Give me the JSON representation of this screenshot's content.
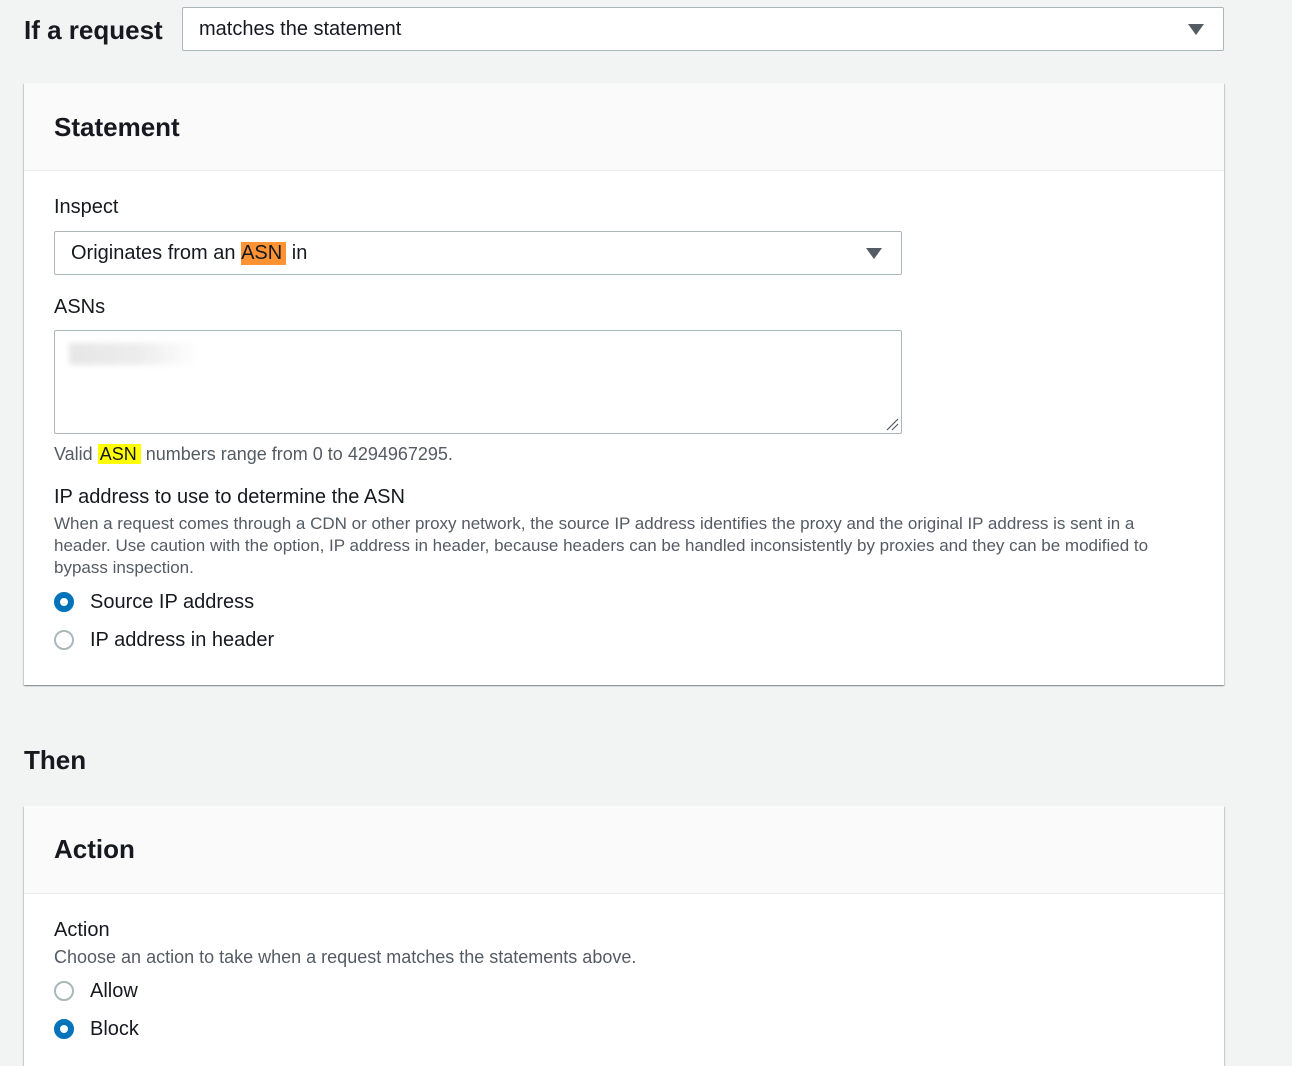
{
  "rule": {
    "if_label": "If a request",
    "match_select": {
      "value": "matches the statement"
    }
  },
  "statement": {
    "title": "Statement",
    "inspect": {
      "label": "Inspect",
      "value_prefix": "Originates from an ",
      "value_highlight": "ASN",
      "value_suffix": " in"
    },
    "asns": {
      "label": "ASNs",
      "value": "",
      "hint_prefix": "Valid ",
      "hint_highlight": "ASN",
      "hint_suffix": " numbers range from 0 to 4294967295."
    },
    "ip_source": {
      "label": "IP address to use to determine the ASN",
      "description": "When a request comes through a CDN or other proxy network, the source IP address identifies the proxy and the original IP address is sent in a header. Use caution with the option, IP address in header, because headers can be handled inconsistently by proxies and they can be modified to bypass inspection.",
      "options": [
        {
          "label": "Source IP address",
          "selected": true
        },
        {
          "label": "IP address in header",
          "selected": false
        }
      ]
    }
  },
  "then_label": "Then",
  "action": {
    "title": "Action",
    "field_label": "Action",
    "description": "Choose an action to take when a request matches the statements above.",
    "options": [
      {
        "label": "Allow",
        "selected": false
      },
      {
        "label": "Block",
        "selected": true
      }
    ]
  },
  "colors": {
    "page_bg": "#f2f3f3",
    "radio_selected": "#0073bb",
    "highlight_orange": "#ff9233",
    "highlight_yellow": "#ffff00"
  }
}
